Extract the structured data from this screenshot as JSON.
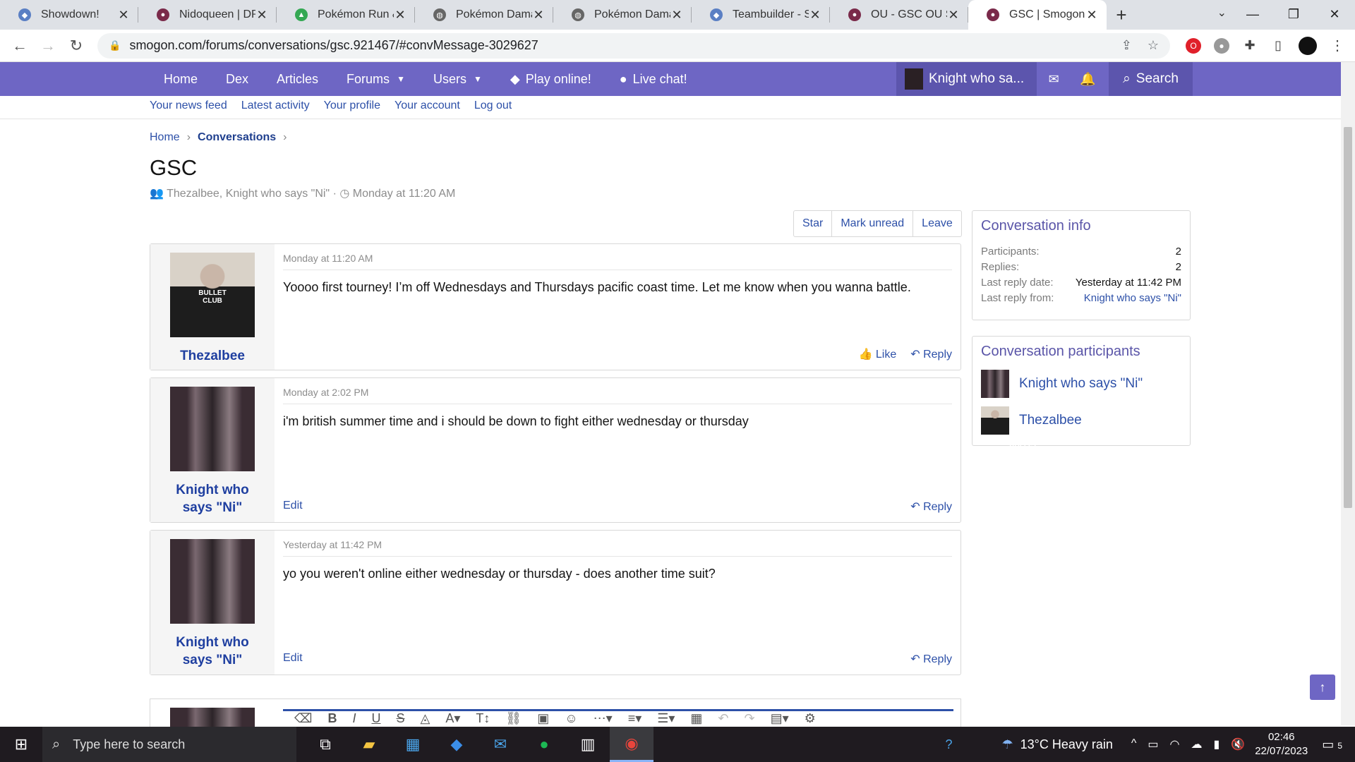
{
  "browser": {
    "tabs": [
      {
        "label": "Showdown!",
        "icon": "showdown-icon",
        "color": "#5a7fc4"
      },
      {
        "label": "Nidoqueen | DP | ",
        "icon": "smogon-icon",
        "color": "#7a2a4a"
      },
      {
        "label": "Pokémon Run & ",
        "icon": "google-drive-icon",
        "color": "#34a853"
      },
      {
        "label": "Pokémon Damag",
        "icon": "globe-icon",
        "color": "#666"
      },
      {
        "label": "Pokémon Damag",
        "icon": "globe-icon",
        "color": "#666"
      },
      {
        "label": "Teambuilder - Sh",
        "icon": "showdown-icon",
        "color": "#5a7fc4"
      },
      {
        "label": "OU - GSC OU San",
        "icon": "smogon-icon",
        "color": "#7a2a4a"
      },
      {
        "label": "GSC | Smogon Fo",
        "icon": "smogon-icon",
        "color": "#7a2a4a",
        "active": true
      }
    ],
    "url": "smogon.com/forums/conversations/gsc.921467/#convMessage-3029627"
  },
  "nav": {
    "items": [
      "Home",
      "Dex",
      "Articles",
      "Forums",
      "Users",
      "Play online!",
      "Live chat!"
    ],
    "user": "Knight who sa...",
    "search": "Search"
  },
  "subnav": [
    "Your news feed",
    "Latest activity",
    "Your profile",
    "Your account",
    "Log out"
  ],
  "breadcrumb": {
    "home": "Home",
    "current": "Conversations",
    "sep": "›"
  },
  "page": {
    "title": "GSC",
    "meta_participants": "Thezalbee, Knight who says \"Ni\"",
    "meta_sep": "·",
    "meta_date": "Monday at 11:20 AM"
  },
  "actions": [
    "Star",
    "Mark unread",
    "Leave"
  ],
  "messages": [
    {
      "author": "Thezalbee",
      "date": "Monday at 11:20 AM",
      "text": "Yoooo first tourney! I’m off Wednesdays and Thursdays pacific coast time. Let me know when you wanna battle.",
      "like": "Like",
      "reply": "Reply"
    },
    {
      "author": "Knight who says \"Ni\"",
      "date": "Monday at 2:02 PM",
      "text": "i'm british summer time and i should be down to fight either wednesday or thursday",
      "edit": "Edit",
      "reply": "Reply"
    },
    {
      "author": "Knight who says \"Ni\"",
      "date": "Yesterday at 11:42 PM",
      "text": "yo you weren't online either wednesday or thursday - does another time suit?",
      "edit": "Edit",
      "reply": "Reply"
    }
  ],
  "info": {
    "title": "Conversation info",
    "rows": [
      {
        "k": "Participants:",
        "v": "2"
      },
      {
        "k": "Replies:",
        "v": "2"
      },
      {
        "k": "Last reply date:",
        "v": "Yesterday at 11:42 PM"
      },
      {
        "k": "Last reply from:",
        "v": "Knight who says \"Ni\""
      }
    ]
  },
  "participants": {
    "title": "Conversation participants",
    "list": [
      "Knight who says \"Ni\"",
      "Thezalbee"
    ]
  },
  "taskbar": {
    "search_placeholder": "Type here to search",
    "weather": "13°C  Heavy rain",
    "time": "02:46",
    "date": "22/07/2023",
    "notifications": "5"
  },
  "colors": {
    "nav": "#6e66c4",
    "link": "#2d50a8"
  }
}
